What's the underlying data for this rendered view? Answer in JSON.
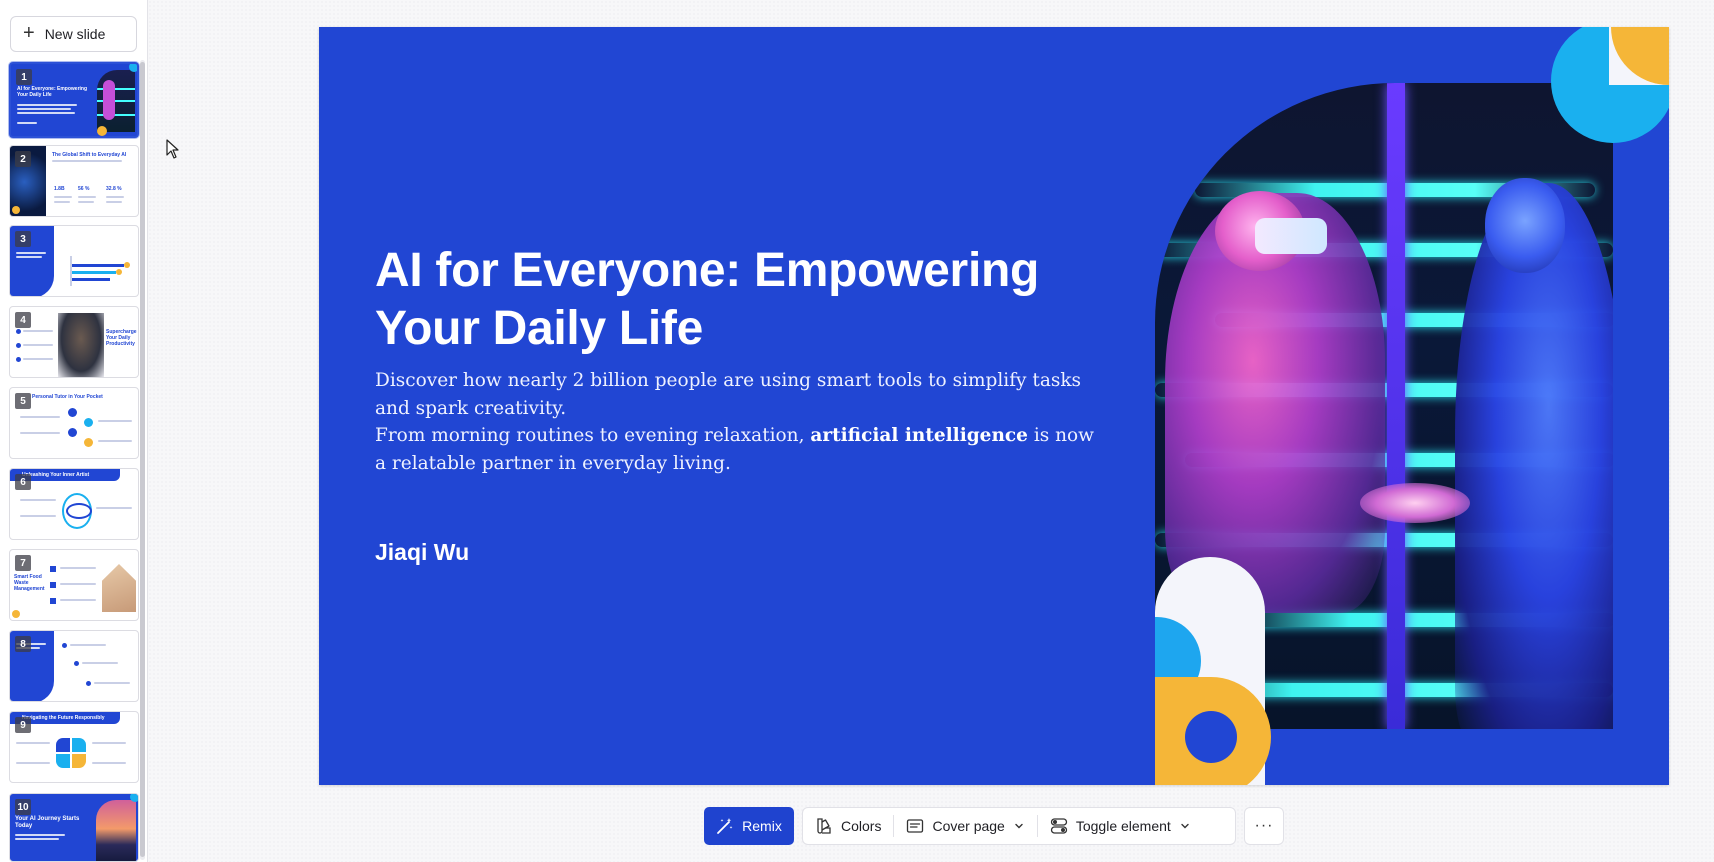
{
  "sidebar": {
    "new_slide_label": "New slide",
    "slides": [
      {
        "number": "1",
        "title": "AI for Everyone: Empowering Your Daily Life",
        "active": true
      },
      {
        "number": "2",
        "title": "The Global Shift to Everyday AI",
        "stats": [
          "1.8B",
          "56 %",
          "32.8 %"
        ]
      },
      {
        "number": "3"
      },
      {
        "number": "4",
        "title": "Supercharge Your Daily Productivity"
      },
      {
        "number": "5",
        "title": "Personal Tutor in Your Pocket"
      },
      {
        "number": "6",
        "title": "Unleashing Your Inner Artist"
      },
      {
        "number": "7",
        "title": "Smart Food Waste Management"
      },
      {
        "number": "8"
      },
      {
        "number": "9",
        "title": "Navigating the Future Responsibly"
      },
      {
        "number": "10",
        "title": "Your AI Journey Starts Today"
      }
    ]
  },
  "slide": {
    "title": "AI for Everyone: Empowering Your Daily Life",
    "desc_line1": "Discover how nearly 2 billion people are using smart tools to simplify tasks and spark creativity.",
    "desc_line2_pre": "From morning routines to evening relaxation, ",
    "desc_line2_bold": "artificial intelligence",
    "desc_line2_post": " is now a relatable partner in everyday living.",
    "author": "Jiaqi Wu"
  },
  "toolbar": {
    "remix_label": "Remix",
    "colors_label": "Colors",
    "layout_label": "Cover page",
    "toggle_label": "Toggle element",
    "more_label": "···"
  },
  "colors": {
    "slide_bg": "#2146d3",
    "accent_yellow": "#f5b638",
    "accent_cyan": "#1ab0ef",
    "remix_bg": "#1f43cf"
  }
}
